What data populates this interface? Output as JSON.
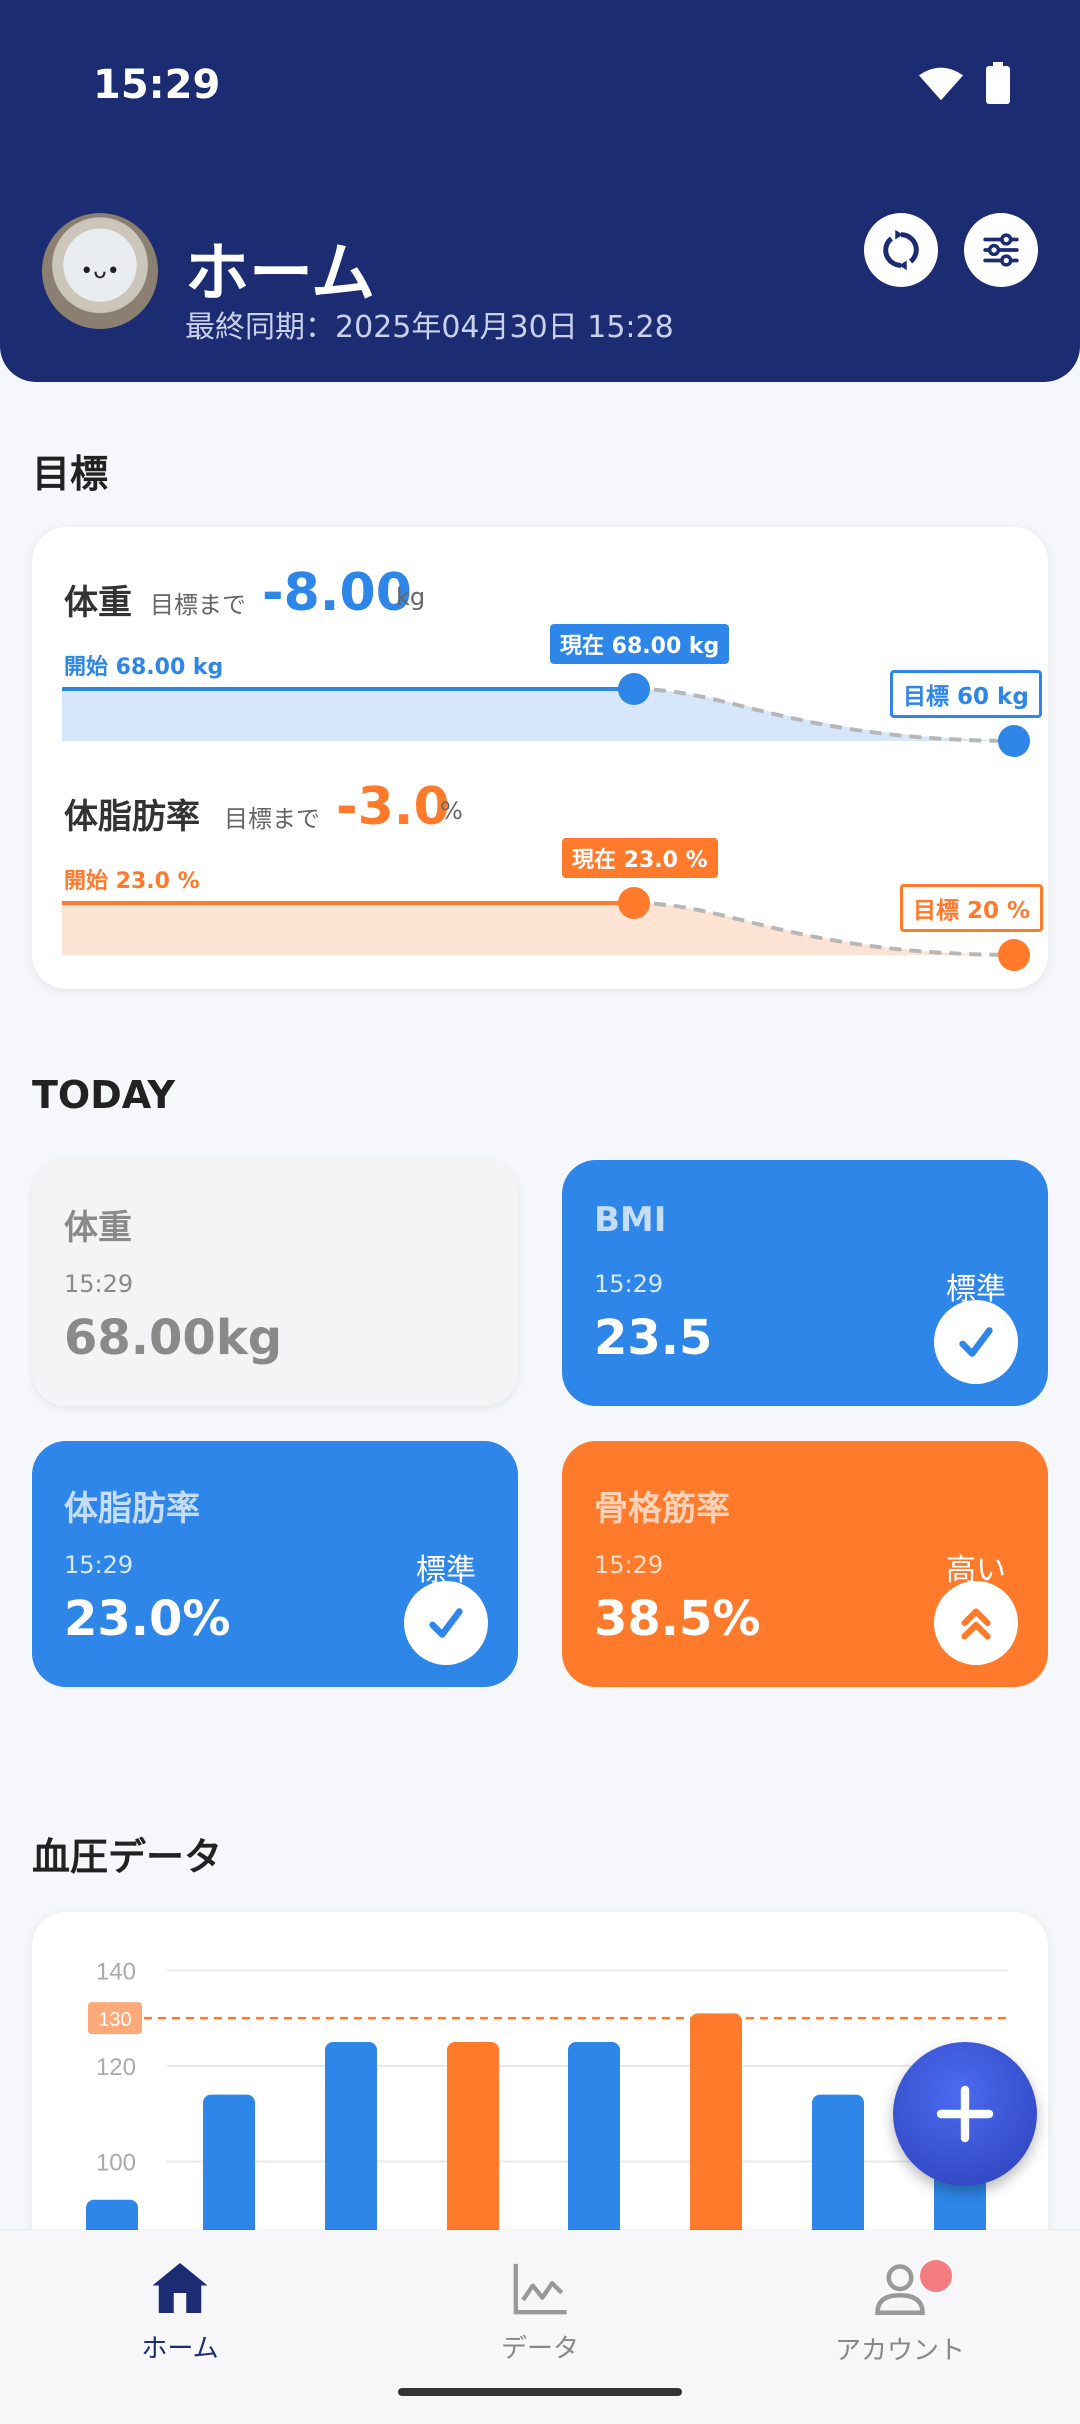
{
  "status_bar": {
    "time": "15:29"
  },
  "header": {
    "title": "ホーム",
    "last_sync": "最終同期：2025年04月30日 15:28",
    "avatar_face": "•ᴗ•"
  },
  "goals": {
    "section_title": "目標",
    "weight": {
      "label": "体重",
      "until_goal": "目標まで",
      "diff": "-8.00",
      "unit": "kg",
      "start": "開始 68.00 kg",
      "current": "現在 68.00 kg",
      "goal": "目標 60 kg",
      "progress": 0.0
    },
    "body_fat": {
      "label": "体脂肪率",
      "until_goal": "目標まで",
      "diff": "-3.0",
      "unit": "%",
      "start": "開始 23.0 %",
      "current": "現在 23.0 %",
      "goal": "目標 20 %",
      "progress": 0.0
    }
  },
  "today": {
    "section_title": "TODAY",
    "tiles": [
      {
        "title": "体重",
        "time": "15:29",
        "value": "68.00kg",
        "status": ""
      },
      {
        "title": "BMI",
        "time": "15:29",
        "value": "23.5",
        "status": "標準",
        "icon": "check-icon"
      },
      {
        "title": "体脂肪率",
        "time": "15:29",
        "value": "23.0%",
        "status": "標準",
        "icon": "check-icon"
      },
      {
        "title": "骨格筋率",
        "time": "15:29",
        "value": "38.5%",
        "status": "高い",
        "icon": "double-chevron-up-icon"
      }
    ]
  },
  "blood_pressure": {
    "section_title": "血圧データ",
    "threshold_label": "130"
  },
  "chart_data": {
    "type": "bar",
    "title": "",
    "y_ticks": [
      "140",
      "120",
      "100"
    ],
    "ylim": [
      93,
      143
    ],
    "threshold": 130,
    "values": [
      92,
      114,
      125,
      125,
      125,
      131,
      114,
      119
    ],
    "colors": [
      "#2E86E8",
      "#2E86E8",
      "#2E86E8",
      "#FF7A2A",
      "#2E86E8",
      "#FF7A2A",
      "#2E86E8",
      "#2E86E8"
    ]
  },
  "nav": {
    "items": [
      {
        "label": "ホーム",
        "icon": "home-icon",
        "active": true
      },
      {
        "label": "データ",
        "icon": "chart-icon",
        "active": false
      },
      {
        "label": "アカウント",
        "icon": "person-icon",
        "active": false
      }
    ]
  },
  "colors": {
    "primary": "#1B2C72",
    "blue": "#2E86E8",
    "orange": "#FF7A2A",
    "grey_tile": "#F4F4F6"
  }
}
